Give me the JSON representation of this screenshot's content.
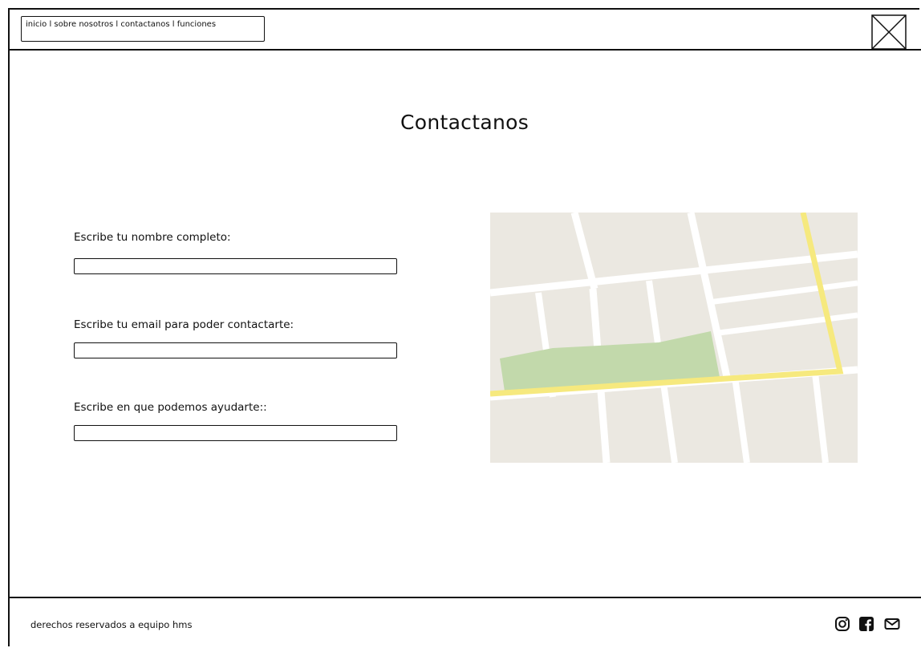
{
  "header": {
    "nav_text": "inicio l sobre nosotros l contactanos l funciones",
    "logo_icon": "image-placeholder-icon"
  },
  "main": {
    "title": "Contactanos",
    "fields": [
      {
        "label": "Escribe tu nombre completo:",
        "value": ""
      },
      {
        "label": "Escribe tu email para poder contactarte:",
        "value": ""
      },
      {
        "label": "Escribe en que podemos ayudarte::",
        "value": ""
      }
    ],
    "map_icon": "map-placeholder"
  },
  "footer": {
    "text": "derechos reservados a equipo hms",
    "icons": [
      "instagram-icon",
      "facebook-icon",
      "mail-icon"
    ]
  },
  "colors": {
    "border": "#111111",
    "map_block": "#ebe8e1",
    "map_park": "#c2d9ab",
    "map_highway": "#f6e97e"
  }
}
